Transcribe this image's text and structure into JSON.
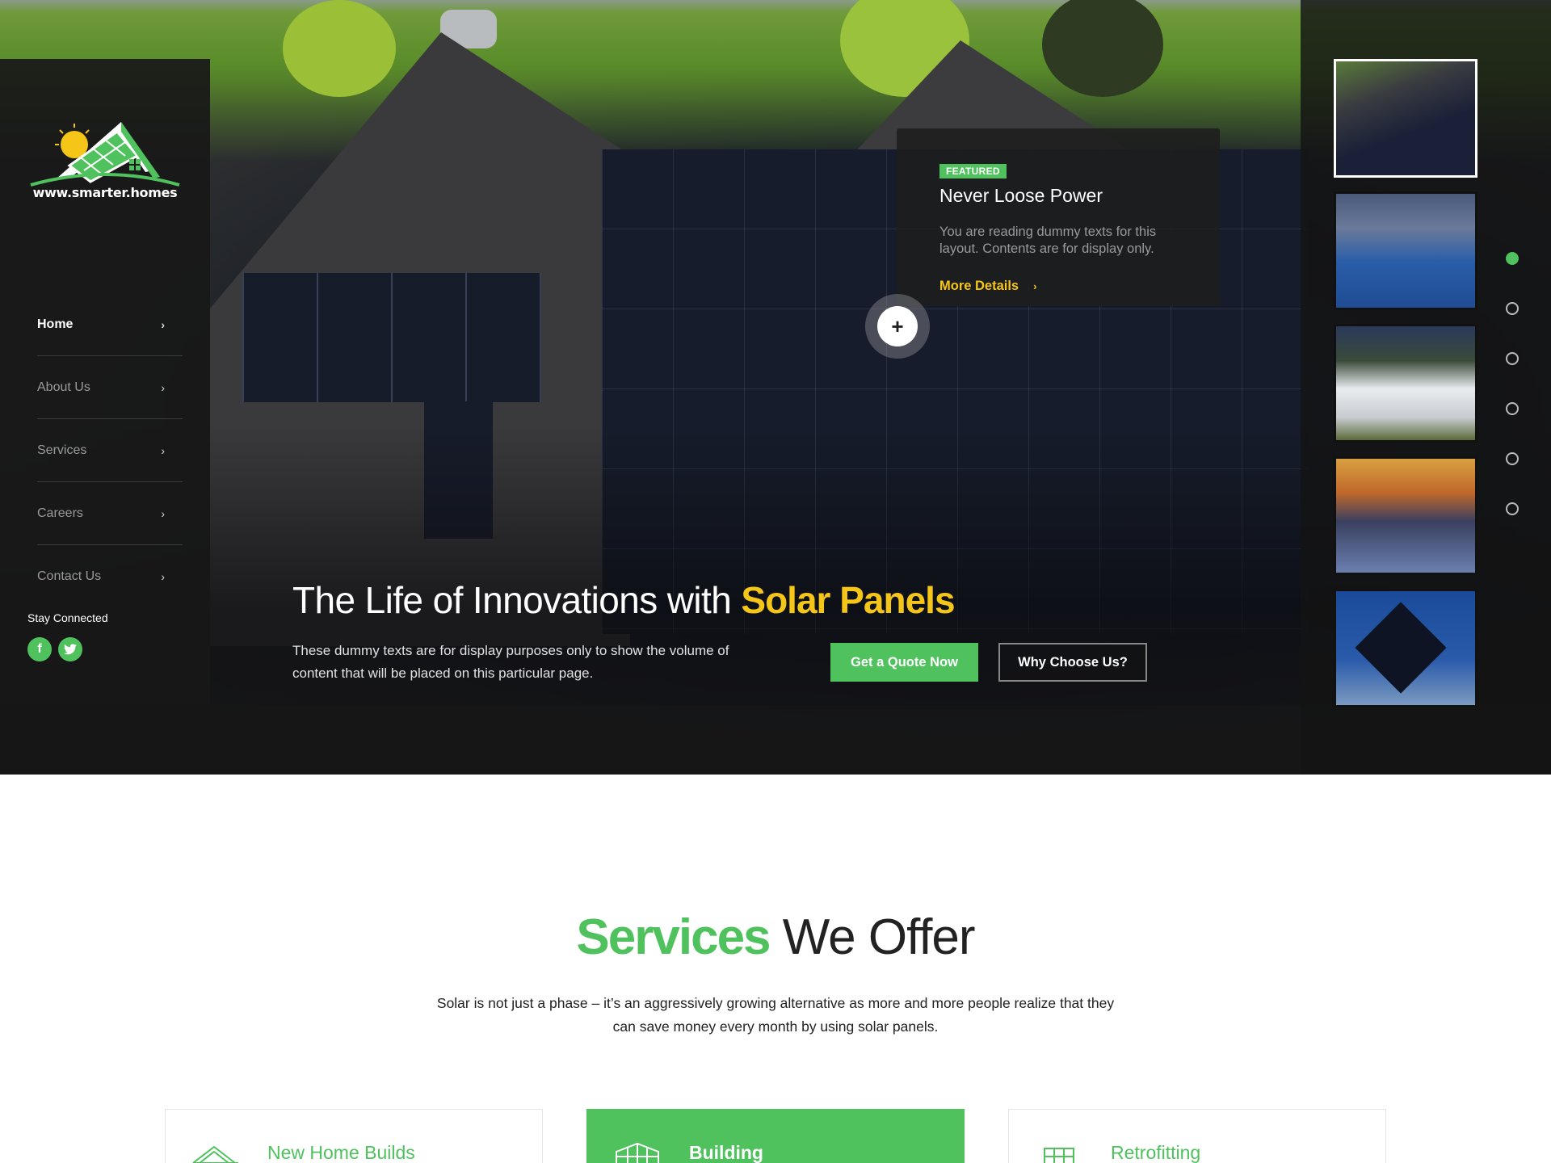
{
  "logo": {
    "text": "www.smarter.homes"
  },
  "nav": {
    "items": [
      {
        "label": "Home",
        "arrow": "›"
      },
      {
        "label": "About Us",
        "arrow": "›"
      },
      {
        "label": "Services",
        "arrow": "›"
      },
      {
        "label": "Careers",
        "arrow": "›"
      },
      {
        "label": "Contact Us",
        "arrow": "›"
      }
    ],
    "active_index": 0
  },
  "social": {
    "title": "Stay Connected",
    "facebook_glyph": "f",
    "twitter_glyph": "t"
  },
  "featured": {
    "badge": "FEATURED",
    "title": "Never Loose Power",
    "description": "You are reading dummy texts for this layout. Contents are for display only.",
    "link": "More Details",
    "link_arrow": "›",
    "plus": "+"
  },
  "hero": {
    "title_prefix": "The Life of Innovations with ",
    "title_highlight": "Solar Panels",
    "description": "These dummy texts are for display purposes only to show the volume of content that will be placed on this particular page.",
    "primary_button": "Get a Quote Now",
    "secondary_button": "Why Choose Us?"
  },
  "slider": {
    "thumbnail_count": 5,
    "active_thumbnail": 0,
    "dot_count": 6,
    "active_dot": 0
  },
  "services": {
    "title_highlight": "Services",
    "title_rest": " We Offer",
    "description": "Solar is not just a phase – it’s an aggressively growing alternative as more and more people realize that they can save money every month by using solar panels.",
    "cards": [
      {
        "label": "New Home Builds",
        "icon": "house-icon"
      },
      {
        "label": "Building",
        "icon": "building-icon"
      },
      {
        "label": "Retrofitting",
        "icon": "solar-panel-icon"
      }
    ]
  },
  "colors": {
    "accent_green": "#4fc25e",
    "accent_yellow": "#f5c518",
    "dark": "#1a1a1a"
  }
}
